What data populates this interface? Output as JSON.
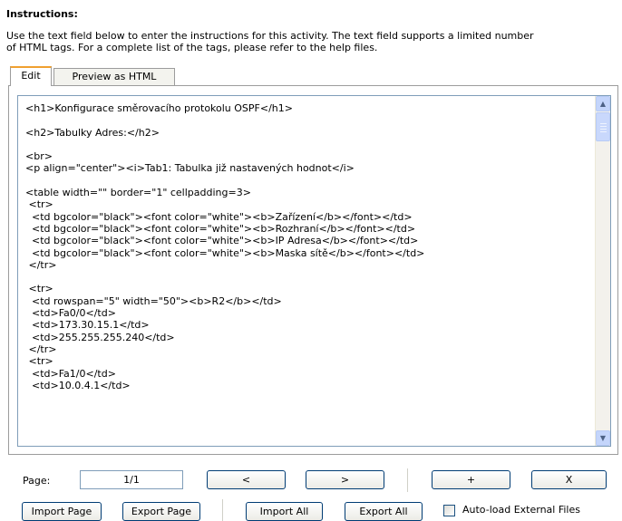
{
  "instructions": {
    "heading": "Instructions:",
    "description_line1": "Use the text field below to enter the instructions for this activity. The text field supports a limited number",
    "description_line2": "of HTML tags. For a complete list of the tags, please refer to the help files."
  },
  "tabs": [
    {
      "label": "Edit",
      "active": true
    },
    {
      "label": "Preview as HTML",
      "active": false
    }
  ],
  "editor": {
    "content": "<h1>Konfigurace směrovacího protokolu OSPF</h1>\n\n<h2>Tabulky Adres:</h2>\n\n<br>\n<p align=\"center\"><i>Tab1: Tabulka již nastavených hodnot</i>\n\n<table width=\"\" border=\"1\" cellpadding=3>\n <tr>\n  <td bgcolor=\"black\"><font color=\"white\"><b>Zařízení</b></font></td>\n  <td bgcolor=\"black\"><font color=\"white\"><b>Rozhraní</b></font></td>\n  <td bgcolor=\"black\"><font color=\"white\"><b>IP Adresa</b></font></td>\n  <td bgcolor=\"black\"><font color=\"white\"><b>Maska sítě</b></font></td>\n </tr>\n\n <tr>\n  <td rowspan=\"5\" width=\"50\"><b>R2</b></td>\n  <td>Fa0/0</td>\n  <td>173.30.15.1</td>\n  <td>255.255.255.240</td>\n </tr>\n <tr>\n  <td>Fa1/0</td>\n  <td>10.0.4.1</td>"
  },
  "pager": {
    "page_label": "Page:",
    "page_value": "1/1",
    "prev_label": "<",
    "next_label": ">",
    "add_label": "+",
    "remove_label": "X"
  },
  "actions": {
    "import_page": "Import Page",
    "export_page": "Export Page",
    "import_all": "Import All",
    "export_all": "Export All",
    "auto_load_label": "Auto-load External Files",
    "auto_load_checked": false
  },
  "colors": {
    "active_tab_accent": "#f0a030",
    "button_border": "#003c74",
    "scrollbar": "#c4d5fb"
  }
}
